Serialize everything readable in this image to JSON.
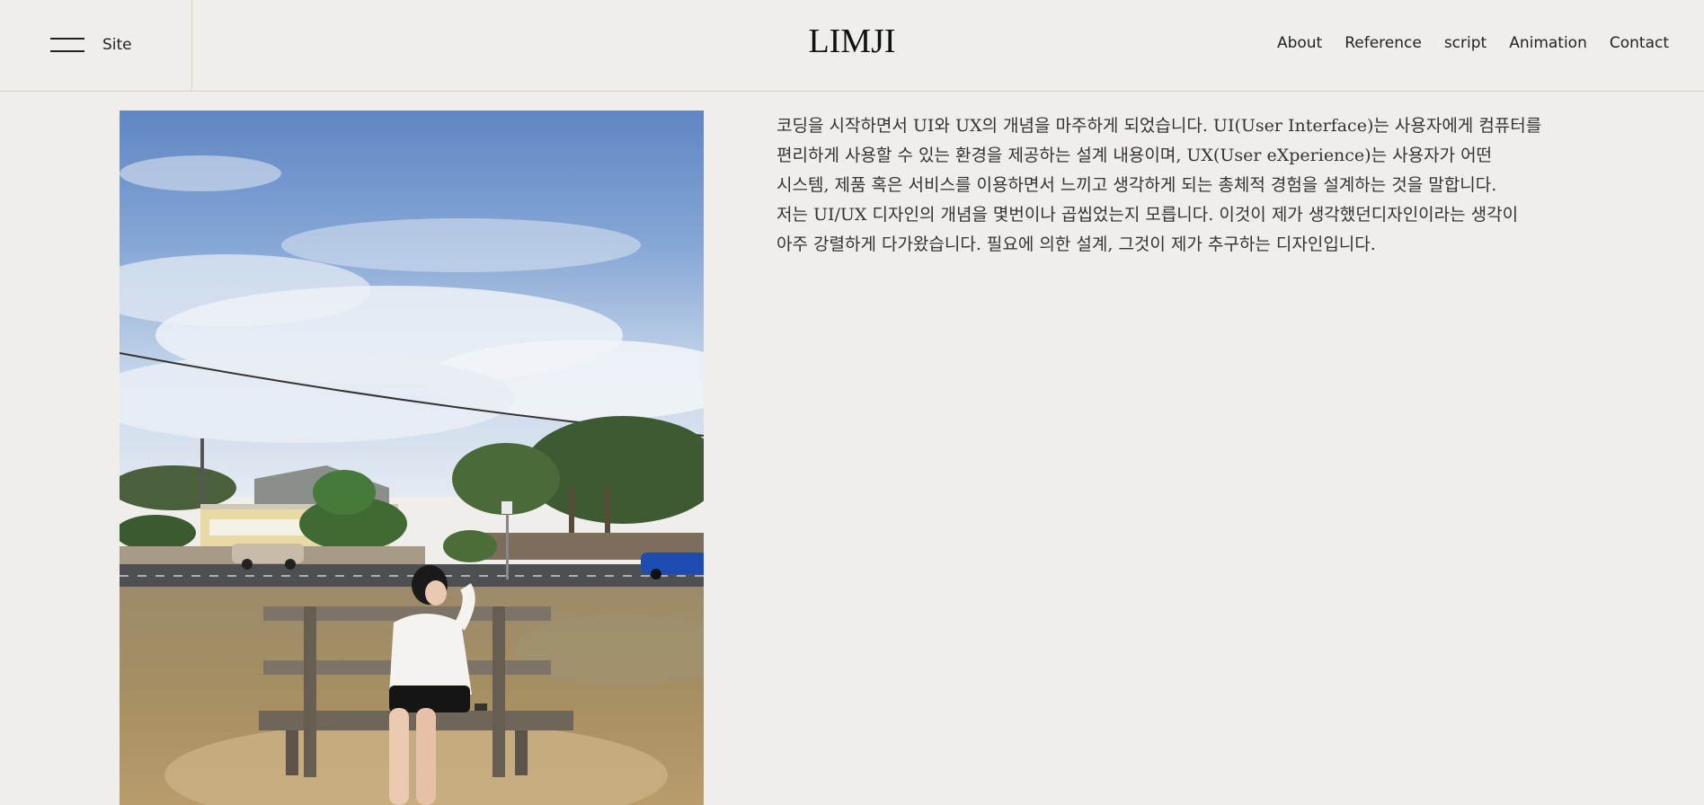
{
  "header": {
    "menu_label": "Site",
    "logo": "LIMJI",
    "nav": [
      "About",
      "Reference",
      "script",
      "Animation",
      "Contact"
    ]
  },
  "intro": {
    "lines": [
      "코딩을 시작하면서 UI와 UX의 개념을 마주하게 되었습니다. UI(User Interface)는 사용자에게 컴퓨터를",
      "편리하게 사용할 수 있는 환경을 제공하는 설계 내용이며, UX(User eXperience)는 사용자가 어떤",
      "시스템, 제품 혹은 서비스를 이용하면서 느끼고 생각하게 되는 총체적 경험을 설계하는 것을 말합니다.",
      "저는 UI/UX 디자인의 개념을 몇번이나 곱씹었는지 모릅니다. 이것이 제가 생각했던디자인이라는 생각이",
      "아주 강렬하게 다가왔습니다. 필요에 의한 설계, 그것이 제가 추구하는 디자인입니다."
    ]
  },
  "colors": {
    "background": "#f0eeea",
    "divider": "#d6d3ce",
    "text": "#222222"
  }
}
